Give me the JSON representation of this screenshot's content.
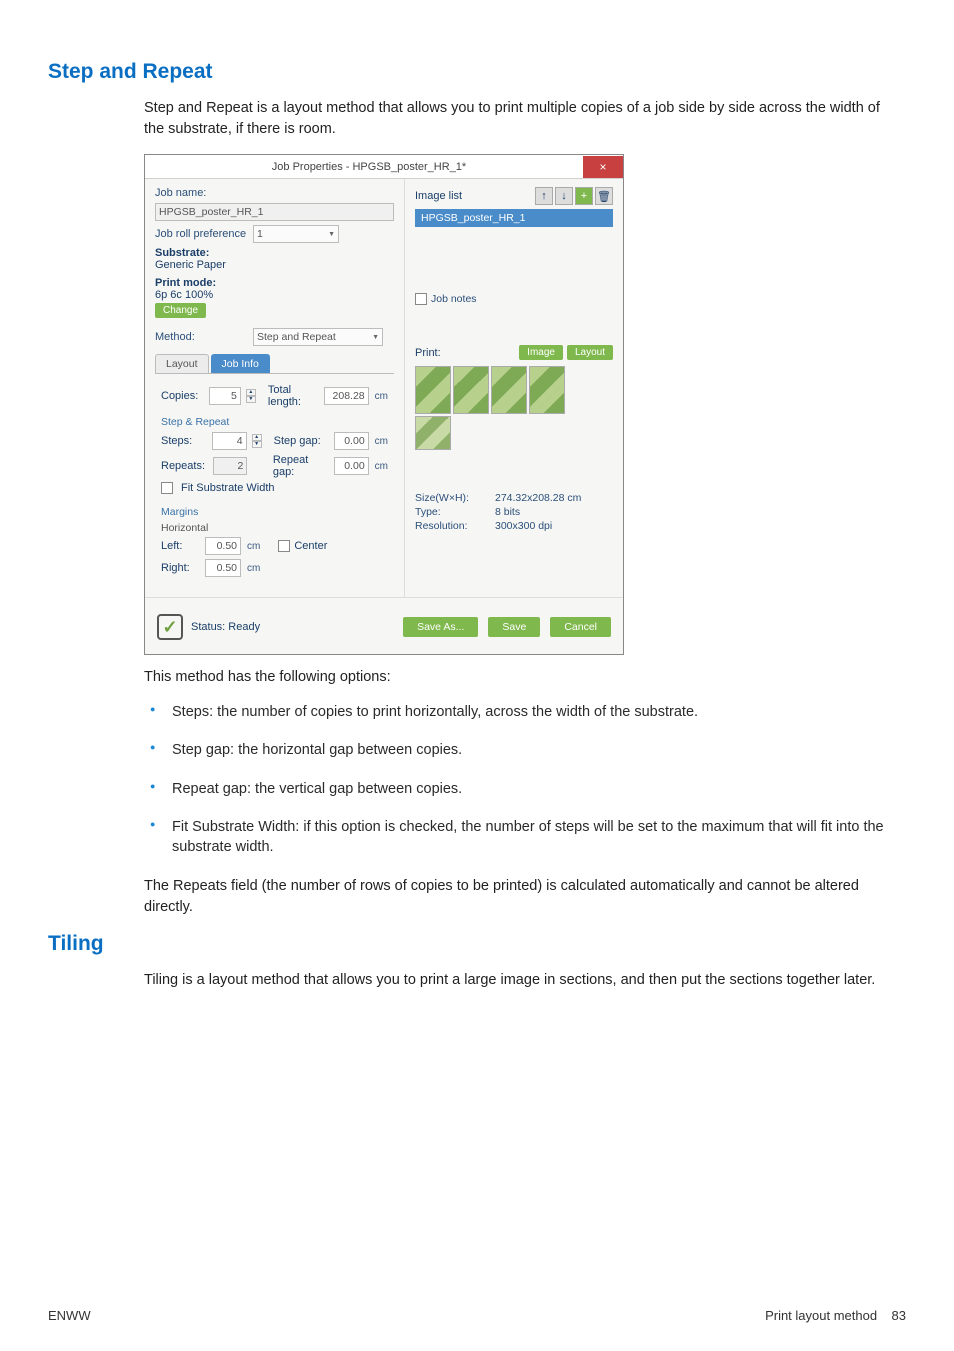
{
  "heading1": "Step and Repeat",
  "para1": "Step and Repeat is a layout method that allows you to print multiple copies of a job side by side across the width of the substrate, if there is room.",
  "dialog": {
    "title": "Job Properties - HPGSB_poster_HR_1*",
    "close": "×",
    "jobname_label": "Job name:",
    "jobname_value": "HPGSB_poster_HR_1",
    "rollpref_label": "Job roll preference",
    "rollpref_value": "1",
    "substrate_label": "Substrate:",
    "substrate_value": "Generic Paper",
    "printmode_label": "Print mode:",
    "printmode_value": "6p 6c 100%",
    "change_btn": "Change",
    "method_label": "Method:",
    "method_value": "Step and Repeat",
    "tab_layout": "Layout",
    "tab_jobinfo": "Job Info",
    "copies_label": "Copies:",
    "copies_value": "5",
    "totallength_label": "Total length:",
    "totallength_value": "208.28",
    "group_steprepeat": "Step & Repeat",
    "steps_label": "Steps:",
    "steps_value": "4",
    "stepgap_label": "Step gap:",
    "stepgap_value": "0.00",
    "repeats_label": "Repeats:",
    "repeats_value": "2",
    "repeatgap_label": "Repeat gap:",
    "repeatgap_value": "0.00",
    "fitsubwidth_label": "Fit Substrate Width",
    "group_margins": "Margins",
    "group_horizontal": "Horizontal",
    "left_label": "Left:",
    "left_value": "0.50",
    "right_label": "Right:",
    "right_value": "0.50",
    "center_label": "Center",
    "unit_cm": "cm",
    "imagelist_label": "Image list",
    "imagelist_item": "HPGSB_poster_HR_1",
    "jobnotes_label": "Job notes",
    "print_label": "Print:",
    "image_btn": "Image",
    "layout_btn": "Layout",
    "size_label": "Size(W×H):",
    "size_value": "274.32x208.28 cm",
    "type_label": "Type:",
    "type_value": "8 bits",
    "res_label": "Resolution:",
    "res_value": "300x300 dpi",
    "status_label": "Status: Ready",
    "saveas_btn": "Save As...",
    "save_btn": "Save",
    "cancel_btn": "Cancel"
  },
  "para2": "This method has the following options:",
  "bullets": [
    "Steps: the number of copies to print horizontally, across the width of the substrate.",
    "Step gap: the horizontal gap between copies.",
    "Repeat gap: the vertical gap between copies.",
    "Fit Substrate Width: if this option is checked, the number of steps will be set to the maximum that will fit into the substrate width."
  ],
  "para3": "The Repeats field (the number of rows of copies to be printed) is calculated automatically and cannot be altered directly.",
  "heading2": "Tiling",
  "para4": "Tiling is a layout method that allows you to print a large image in sections, and then put the sections together later.",
  "footer_left": "ENWW",
  "footer_right_text": "Print layout method",
  "footer_right_page": "83"
}
